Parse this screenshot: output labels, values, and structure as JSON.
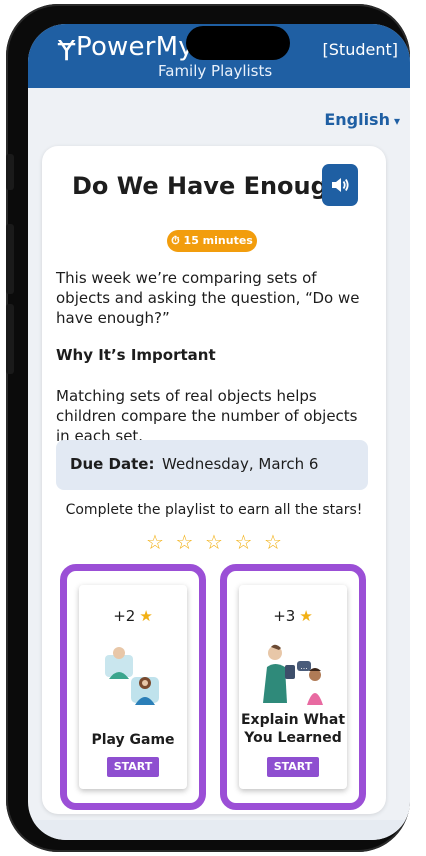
{
  "header": {
    "logo_text": "PowerMyL",
    "subtitle": "Family Playlists",
    "role_link": "[Student]"
  },
  "language": {
    "label": "English",
    "caret": "▾"
  },
  "card": {
    "title": "Do We Have Enough?",
    "duration": "⏱ 15 minutes",
    "description": "This week we’re comparing sets of objects and asking the question, “Do we have enough?”",
    "section_heading": "Why It’s Important",
    "importance": "Matching sets of real objects helps children compare the number of objects in each set.",
    "due_label": "Due Date:",
    "due_value": "Wednesday, March 6",
    "cta": "Complete the playlist to earn all the stars!",
    "stars": {
      "earned": 0,
      "total": 5
    }
  },
  "activities": [
    {
      "points": "+2",
      "label": "Play Game",
      "button": "START"
    },
    {
      "points": "+3",
      "label": "Explain What You Learned",
      "button": "START"
    }
  ],
  "colors": {
    "brand_blue": "#1f5fa3",
    "badge_orange": "#f29d0d",
    "accent_purple": "#9b4fd6",
    "star_yellow": "#f2b014"
  }
}
